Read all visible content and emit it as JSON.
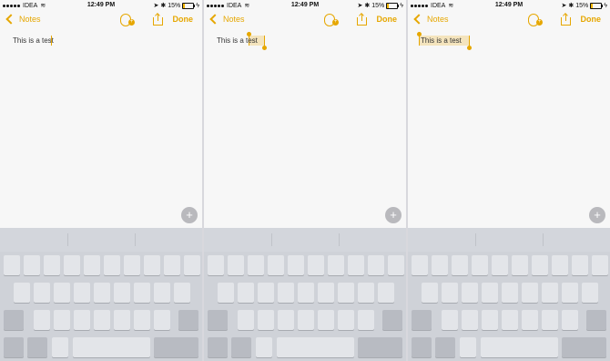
{
  "status": {
    "carrier": "IDEA",
    "time": "12:49 PM",
    "battery": "15%",
    "battery_level": 0.15
  },
  "nav": {
    "back_label": "Notes",
    "done_label": "Done"
  },
  "colors": {
    "accent": "#e6a700",
    "background": "#f7f7f7",
    "keyboard": "#cfd2d8"
  },
  "panels": [
    {
      "note_text": "This is a test",
      "selection": "none"
    },
    {
      "note_text": "This is a test",
      "selection": "word"
    },
    {
      "note_text": "This is a test",
      "selection": "all"
    }
  ],
  "icons": {
    "add_people": "add-people-icon",
    "share": "share-icon",
    "back": "chevron-left-icon",
    "plus": "plus-icon"
  }
}
